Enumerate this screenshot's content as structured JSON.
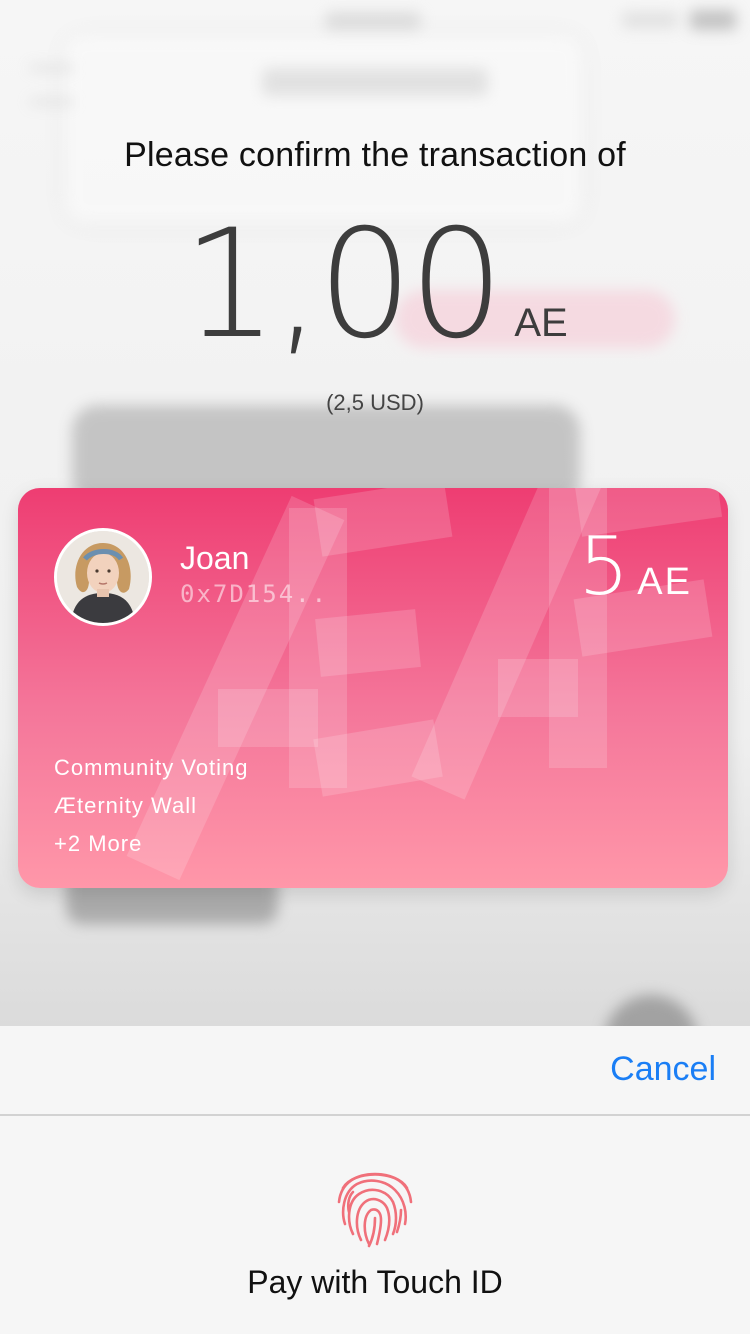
{
  "confirm": {
    "title": "Please confirm the transaction of",
    "amount": "1,00",
    "unit": "AE",
    "fiat": "(2,5 USD)"
  },
  "account": {
    "name": "Joan",
    "address": "0x7D154..",
    "balance": "5",
    "balance_unit": "AE",
    "apps": [
      "Community Voting",
      "Æternity Wall",
      "+2 More"
    ]
  },
  "sheet": {
    "cancel_label": "Cancel",
    "pay_label": "Pay with Touch ID"
  },
  "icons": {
    "fingerprint": "fingerprint-icon",
    "avatar": "avatar"
  },
  "colors": {
    "card_top": "#ee3d72",
    "card_bottom": "#ff97a9",
    "accent": "#1a7ef5",
    "fingerprint": "#f0707a"
  }
}
